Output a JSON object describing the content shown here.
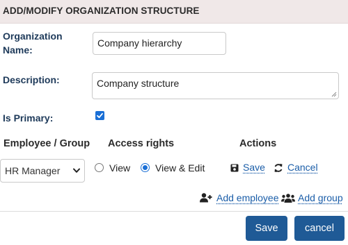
{
  "header": {
    "title": "ADD/MODIFY ORGANIZATION STRUCTURE"
  },
  "form": {
    "org_name_label_line1": "Organization",
    "org_name_label_line2": "Name:",
    "org_name_value": "Company hierarchy",
    "description_label": "Description:",
    "description_value": "Company structure",
    "is_primary_label": "Is Primary:",
    "is_primary_checked": true
  },
  "table": {
    "headers": [
      "Employee / Group",
      "Access rights",
      "Actions"
    ],
    "row": {
      "selected_role": "HR Manager",
      "access_options": [
        "View",
        "View & Edit"
      ],
      "selected_access": "View & Edit",
      "save_link": "Save",
      "cancel_link": "Cancel"
    }
  },
  "actions": {
    "add_employee": "Add employee",
    "add_group": "Add group"
  },
  "footer": {
    "save_button": "Save",
    "cancel_button": "cancel"
  },
  "colors": {
    "header_bg": "#f0e8e8",
    "primary": "#1f5a96",
    "link": "#1a5da8",
    "label": "#1e3a5a"
  },
  "icons": [
    "check-icon",
    "chevron-down-icon",
    "save-icon",
    "refresh-icon",
    "add-user-icon",
    "users-icon"
  ]
}
